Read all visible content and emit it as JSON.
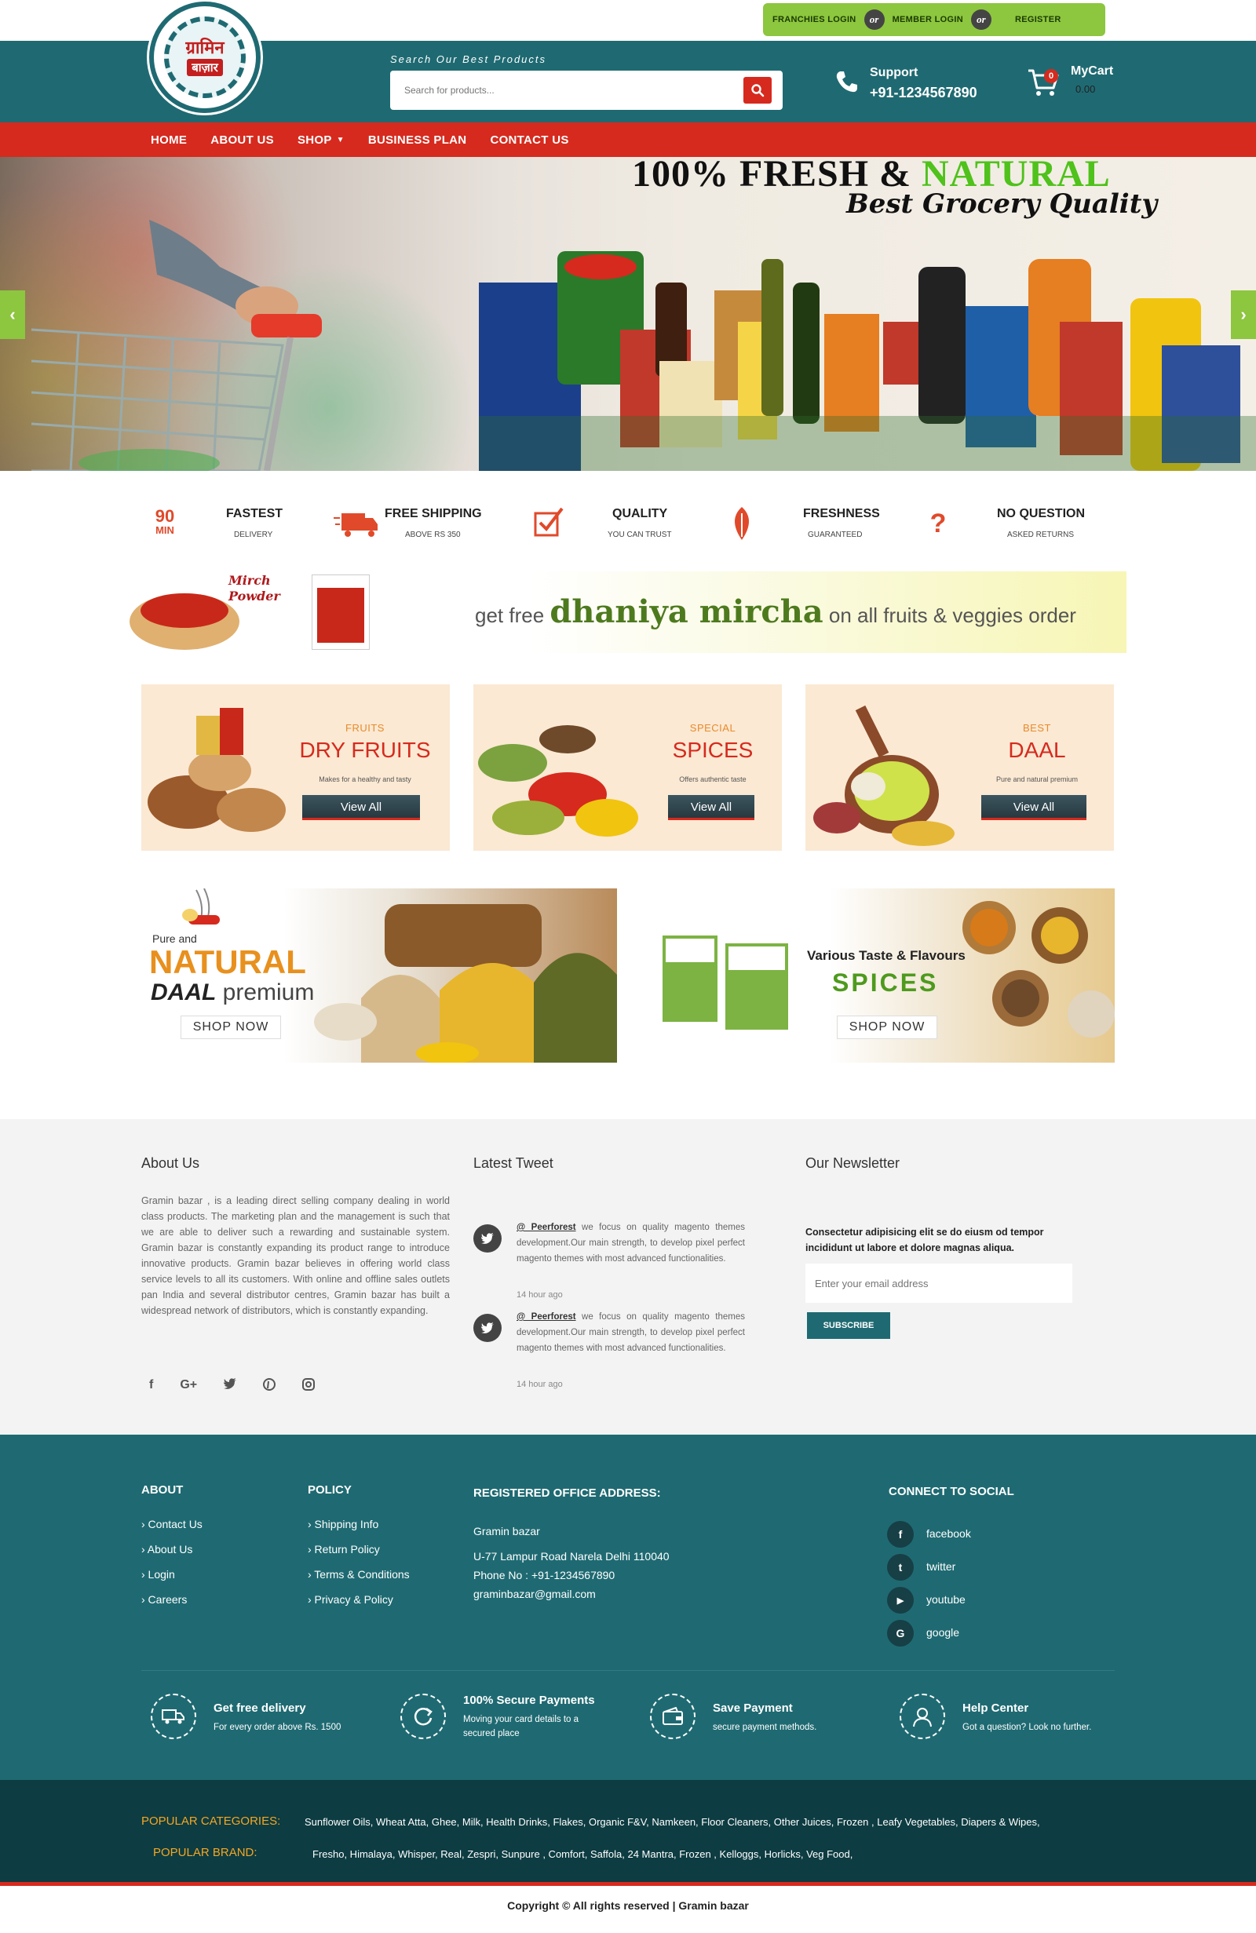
{
  "topbar": {
    "franchise_login": "FRANCHIES LOGIN",
    "or1": "or",
    "member_login": "MEMBER LOGIN",
    "or2": "or",
    "register": "REGISTER"
  },
  "logo": {
    "line1": "ग्रामिन",
    "line2": "बाज़ार"
  },
  "search": {
    "caption": "Search Our Best Products",
    "placeholder": "Search for products..."
  },
  "support": {
    "label": "Support",
    "phone": "+91-1234567890"
  },
  "cart": {
    "count": "0",
    "label": "MyCart",
    "amount": "0.00"
  },
  "nav": {
    "items": [
      "HOME",
      "ABOUT US",
      "SHOP",
      "BUSINESS PLAN",
      "CONTACT US"
    ]
  },
  "hero": {
    "headline_a": "100% FRESH & ",
    "headline_b": "NATURAL",
    "tagline": "Best Grocery Quality"
  },
  "features": [
    {
      "icon": "90-min-icon",
      "badge_top": "90",
      "badge_bottom": "MIN",
      "title": "FASTEST",
      "sub": "DELIVERY"
    },
    {
      "icon": "truck-icon",
      "title": "FREE SHIPPING",
      "sub": "ABOVE RS 350"
    },
    {
      "icon": "check-icon",
      "title": "QUALITY",
      "sub": "YOU CAN TRUST"
    },
    {
      "icon": "leaf-icon",
      "title": "FRESHNESS",
      "sub": "GUARANTEED"
    },
    {
      "icon": "question-icon",
      "title": "NO QUESTION",
      "sub": "ASKED RETURNS"
    }
  ],
  "promo": {
    "label": "Mirch Powder",
    "pre": "get free ",
    "highlight": "dhaniya mircha",
    "post": " on all fruits & veggies order"
  },
  "categories": [
    {
      "small": "FRUITS",
      "title": "DRY FRUITS",
      "desc": "Makes for a healthy and tasty",
      "button": "View All"
    },
    {
      "small": "SPECIAL",
      "title": "SPICES",
      "desc": "Offers authentic taste",
      "button": "View All"
    },
    {
      "small": "BEST",
      "title": "DAAL",
      "desc": "Pure and natural premium",
      "button": "View All"
    }
  ],
  "banners": [
    {
      "pre": "Pure and",
      "big": "NATURAL",
      "sub1": "DAAL",
      "sub2": " premium",
      "button": "SHOP NOW"
    },
    {
      "pre": "Various Taste & Flavours",
      "big": "SPICES",
      "button": "SHOP NOW"
    }
  ],
  "about": {
    "heading": "About Us",
    "text": "Gramin bazar , is a leading direct selling company dealing in world class products. The marketing plan and the management is such that we are able to deliver such a rewarding and sustainable system. Gramin bazar is constantly expanding its product range to introduce innovative products. Gramin bazar believes in offering world class service levels to all its customers. With online and offline sales outlets pan India and several distributor centres, Gramin bazar has built a widespread network of distributors, which is constantly expanding.",
    "socials": [
      "f",
      "G+",
      "twitter-icon",
      "pinterest-icon",
      "instagram-icon"
    ]
  },
  "tweets": {
    "heading": "Latest Tweet",
    "items": [
      {
        "user": "@ Peerforest",
        "text": " we focus on quality magento themes development.Our main strength, to develop pixel perfect magento themes with most advanced functionalities.",
        "time": "14 hour ago"
      },
      {
        "user": "@ Peerforest",
        "text": " we focus on quality magento themes development.Our main strength, to develop pixel perfect magento themes with most advanced functionalities.",
        "time": "14 hour ago"
      }
    ]
  },
  "newsletter": {
    "heading": "Our Newsletter",
    "text": "Consectetur adipisicing elit se do eiusm od tempor incididunt ut labore et dolore magnas aliqua.",
    "placeholder": "Enter your email address",
    "button": "SUBSCRIBE"
  },
  "footer": {
    "about_h": "ABOUT",
    "about_links": [
      "› Contact Us",
      "› About Us",
      "› Login",
      "› Careers"
    ],
    "policy_h": "POLICY",
    "policy_links": [
      "› Shipping Info",
      "› Return Policy",
      "› Terms & Conditions",
      "› Privacy & Policy"
    ],
    "office_h": "REGISTERED OFFICE ADDRESS:",
    "office_name": "Gramin bazar",
    "office_addr": "U-77 Lampur Road Narela Delhi 110040",
    "office_phone": "Phone No : +91-1234567890",
    "office_email": "graminbazar@gmail.com",
    "social_h": "CONNECT TO SOCIAL",
    "social": [
      {
        "glyph": "f",
        "name": "facebook"
      },
      {
        "glyph": "t",
        "name": "twitter"
      },
      {
        "glyph": "▶",
        "name": "youtube"
      },
      {
        "glyph": "G",
        "name": "google"
      }
    ]
  },
  "services": [
    {
      "icon": "delivery-truck-icon",
      "title": "Get free delivery",
      "sub": "For every order above Rs. 1500"
    },
    {
      "icon": "secure-refresh-icon",
      "title": "100% Secure Payments",
      "sub": "Moving your card details to a secured place"
    },
    {
      "icon": "wallet-icon",
      "title": "Save Payment",
      "sub": "secure payment methods."
    },
    {
      "icon": "help-user-icon",
      "title": "Help Center",
      "sub": "Got a question? Look no further."
    }
  ],
  "popular": {
    "cat_h": "POPULAR CATEGORIES:",
    "cat_v": "Sunflower Oils,  Wheat Atta,  Ghee, Milk,  Health Drinks,  Flakes,  Organic F&V,  Namkeen,  Floor Cleaners,  Other Juices,  Frozen ,  Leafy Vegetables,  Diapers & Wipes,",
    "brand_h": "POPULAR BRAND:",
    "brand_v": "Fresho,  Himalaya,  Whisper,  Real,  Zespri,  Sunpure ,  Comfort,  Saffola,  24 Mantra,  Frozen ,  Kelloggs,  Horlicks,  Veg Food,"
  },
  "copyright": "Copyright © All rights reserved | Gramin bazar",
  "colors": {
    "teal": "#1f6a72",
    "red": "#d62a1e",
    "green": "#8dc63f",
    "dark": "#0d3c42"
  }
}
